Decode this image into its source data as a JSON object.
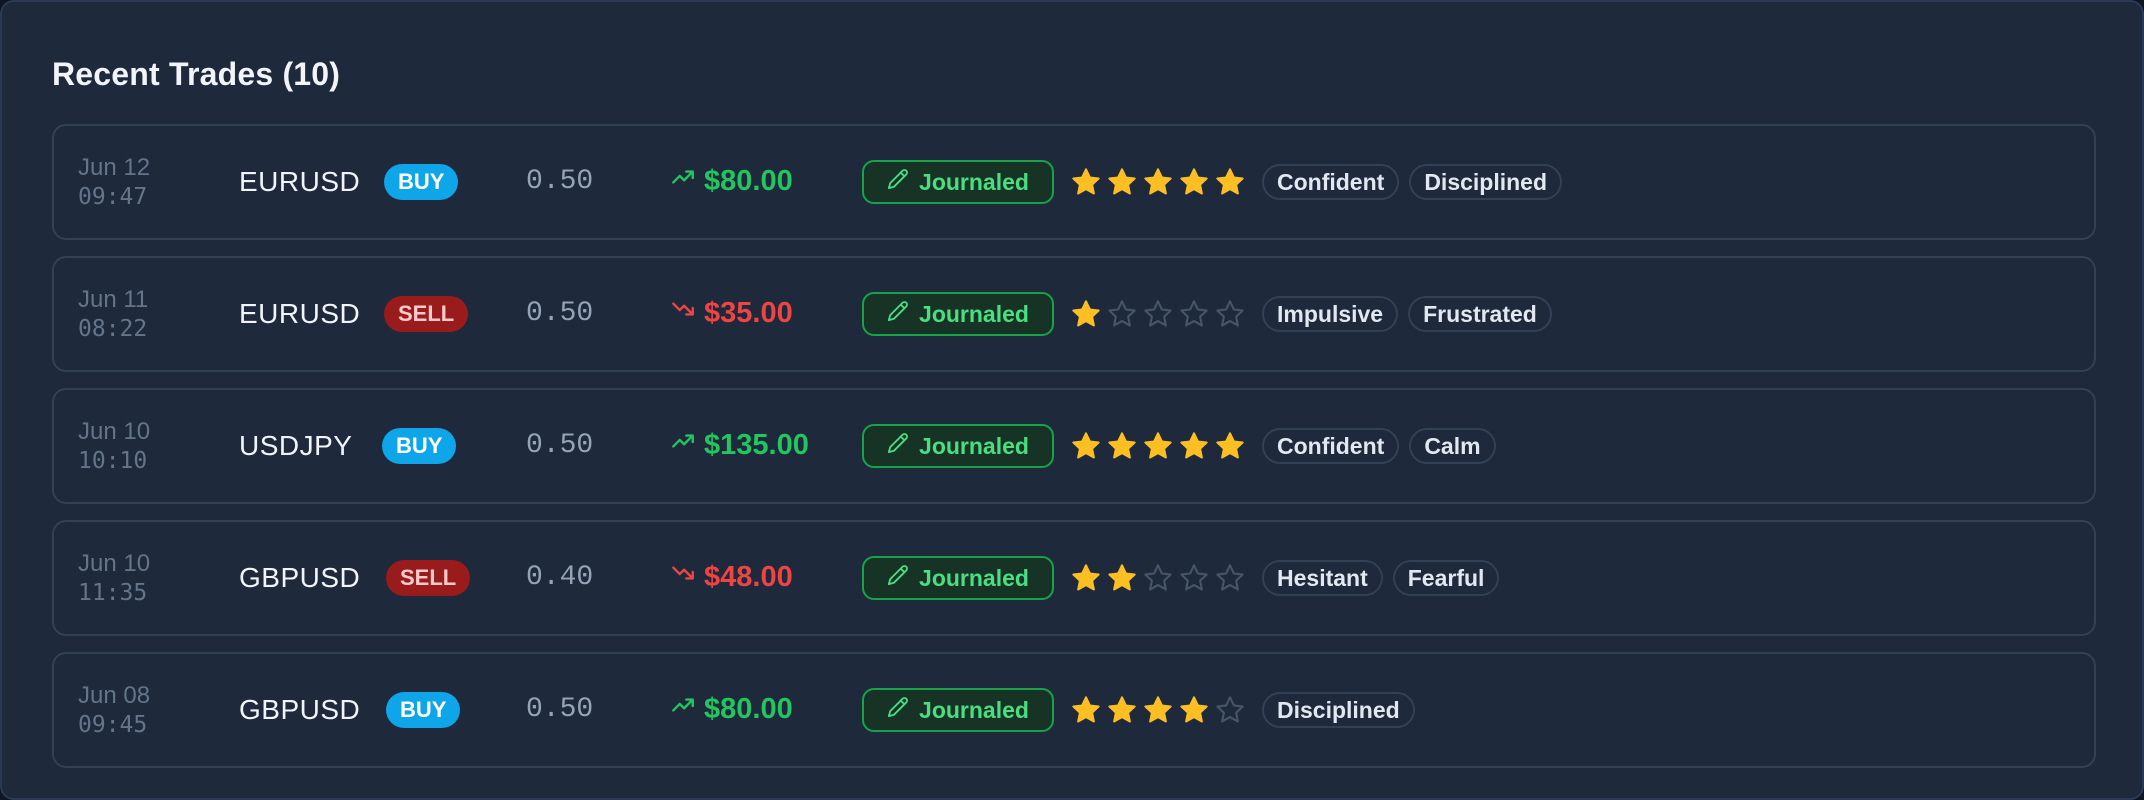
{
  "panel": {
    "title": "Recent Trades (10)"
  },
  "journal_label": "Journaled",
  "colors": {
    "buy": "#0ea5e9",
    "sell": "#991b1b",
    "win": "#22c55e",
    "loss": "#ef4444",
    "star_filled": "#fbbf24",
    "star_empty": "#475569"
  },
  "trades": [
    {
      "date": "Jun 12",
      "time": "09:47",
      "symbol": "EURUSD",
      "side": "BUY",
      "size": "0.50",
      "pnl": "$80.00",
      "direction": "up",
      "rating": 5,
      "tags": [
        "Confident",
        "Disciplined"
      ]
    },
    {
      "date": "Jun 11",
      "time": "08:22",
      "symbol": "EURUSD",
      "side": "SELL",
      "size": "0.50",
      "pnl": "$35.00",
      "direction": "down",
      "rating": 1,
      "tags": [
        "Impulsive",
        "Frustrated"
      ]
    },
    {
      "date": "Jun 10",
      "time": "10:10",
      "symbol": "USDJPY",
      "side": "BUY",
      "size": "0.50",
      "pnl": "$135.00",
      "direction": "up",
      "rating": 5,
      "tags": [
        "Confident",
        "Calm"
      ]
    },
    {
      "date": "Jun 10",
      "time": "11:35",
      "symbol": "GBPUSD",
      "side": "SELL",
      "size": "0.40",
      "pnl": "$48.00",
      "direction": "down",
      "rating": 2,
      "tags": [
        "Hesitant",
        "Fearful"
      ]
    },
    {
      "date": "Jun 08",
      "time": "09:45",
      "symbol": "GBPUSD",
      "side": "BUY",
      "size": "0.50",
      "pnl": "$80.00",
      "direction": "up",
      "rating": 4,
      "tags": [
        "Disciplined"
      ]
    }
  ]
}
